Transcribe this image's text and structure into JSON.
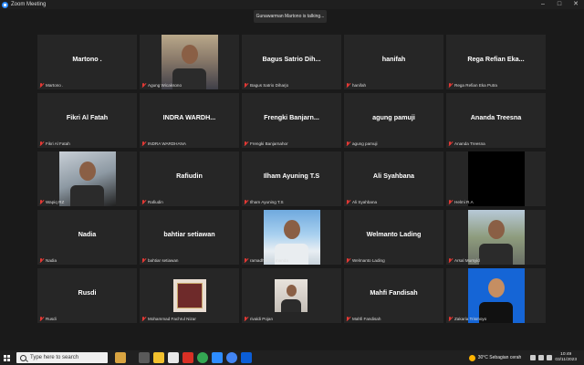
{
  "window": {
    "title": "Zoom Meeting"
  },
  "speaking_banner": "Gunawarman Martono is talking...",
  "tiles": [
    {
      "name": "Martono .",
      "label": "Martono .",
      "video": false
    },
    {
      "name": "",
      "label": "Agung Wicaksono",
      "video": true,
      "photo": "agung"
    },
    {
      "name": "Bagus Satrio Dih...",
      "label": "Bagus Satrio Diharjo",
      "video": false
    },
    {
      "name": "hanifah",
      "label": "hanifah",
      "video": false
    },
    {
      "name": "Rega Refian Eka...",
      "label": "Rega Refian Eka Putra",
      "video": false
    },
    {
      "name": "Fikri Al Fatah",
      "label": "Fikri Al Fatah",
      "video": false
    },
    {
      "name": "INDRA  WARDH...",
      "label": "INDRA WARDHANA",
      "video": false
    },
    {
      "name": "Frengki  Banjarn...",
      "label": "Frengki Banjarnahor",
      "video": false
    },
    {
      "name": "agung pamuji",
      "label": "agung pamuji",
      "video": false
    },
    {
      "name": "Ananda Treesna",
      "label": "Ananda Treesna",
      "video": false
    },
    {
      "name": "",
      "label": "Wapiq RZ",
      "video": true,
      "photo": "wapiq"
    },
    {
      "name": "Rafiudin",
      "label": "Rafiudin",
      "video": false
    },
    {
      "name": "Ilham Ayuning T.S",
      "label": "Ilham Ayuning T.S",
      "video": false
    },
    {
      "name": "Ali Syahbana",
      "label": "Ali Syahbana",
      "video": false
    },
    {
      "name": "",
      "label": "Helmi R.A",
      "video": true,
      "photo": "helmi"
    },
    {
      "name": "Nadia",
      "label": "Nadia",
      "video": false
    },
    {
      "name": "bahtiar setiawan",
      "label": "bahtiar setiawan",
      "video": false
    },
    {
      "name": "",
      "label": "ramadhan c.l manda",
      "video": true,
      "photo": "ramadhan"
    },
    {
      "name": "Welmanto Lading",
      "label": "Welmanto Lading",
      "video": false
    },
    {
      "name": "",
      "label": "Arsal Mursyid",
      "video": true,
      "photo": "arsal"
    },
    {
      "name": "Rusdi",
      "label": "Rusdi",
      "video": false
    },
    {
      "name": "",
      "label": "Mohammad Fachrul Nizar",
      "video": true,
      "photo": "fachrul"
    },
    {
      "name": "",
      "label": "rivaldi Pojan",
      "video": true,
      "photo": "rivaldi"
    },
    {
      "name": "Mahfi Fandisah",
      "label": "Mahfi Fandisah",
      "video": false
    },
    {
      "name": "",
      "label": "Zakaria Trismoyo",
      "video": true,
      "photo": "zakaria"
    }
  ],
  "taskbar": {
    "search_placeholder": "Type here to search",
    "weather": "30°C  Sebagian cerah",
    "time": "10:49",
    "date": "03/11/2023"
  },
  "colors": {
    "mute": "#e53935",
    "tile_bg": "#262626",
    "app_bg": "#1a1a1a"
  }
}
